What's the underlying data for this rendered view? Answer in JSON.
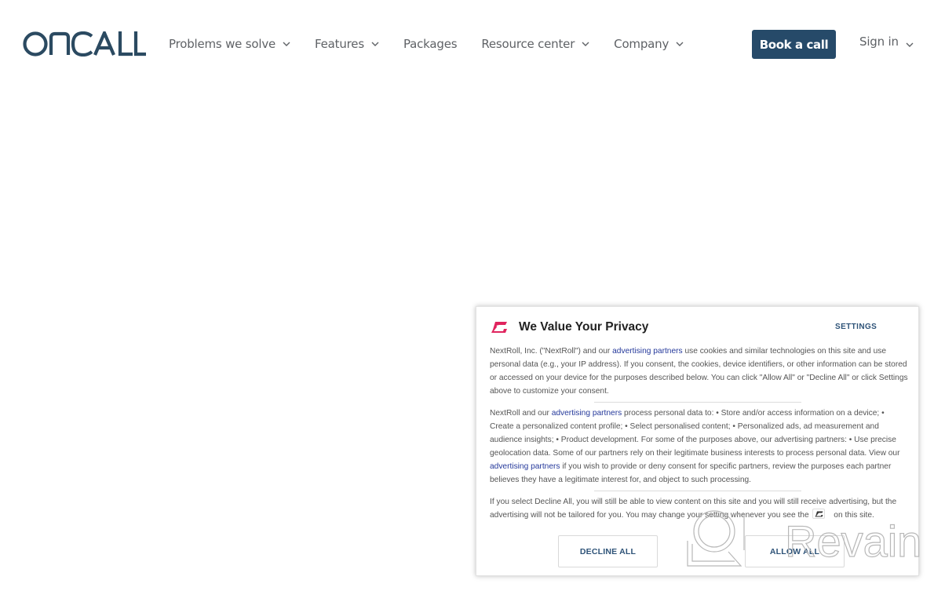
{
  "header": {
    "logo_text": "ONCALL",
    "nav": [
      {
        "label": "Problems we solve",
        "has_dropdown": true
      },
      {
        "label": "Features",
        "has_dropdown": true
      },
      {
        "label": "Packages",
        "has_dropdown": false
      },
      {
        "label": "Resource center",
        "has_dropdown": true
      },
      {
        "label": "Company",
        "has_dropdown": true
      }
    ],
    "cta_label": "Book a call",
    "signin_label": "Sign in"
  },
  "consent": {
    "title": "We Value Your Privacy",
    "settings_label": "SETTINGS",
    "p1": {
      "before": "NextRoll, Inc. (\"NextRoll\") and our ",
      "link": "advertising partners",
      "after": " use cookies and similar technologies on this site and use personal data (e.g., your IP address). If you consent, the cookies, device identifiers, or other information can be stored or accessed on your device for the purposes described below. You can click \"Allow All\" or \"Decline All\" or click Settings above to customize your consent."
    },
    "p2": {
      "before": "NextRoll and our ",
      "link": "advertising partners",
      "middle": " process personal data to: • Store and/or access information on a device; • Create a personalized content profile; • Select personalised content; • Personalized ads, ad measurement and audience insights; • Product development. For some of the purposes above, our advertising partners: • Use precise geolocation data. Some of our partners rely on their legitimate business interests to process personal data. View our ",
      "link2": "advertising partners",
      "after": " if you wish to provide or deny consent for specific partners, review the purposes each partner believes they have a legitimate interest for, and object to such processing."
    },
    "p3": {
      "before": "If you select Decline All, you will still be able to view content on this site and you will still receive advertising, but the advertising will not be tailored for you. You may change your setting whenever you see the ",
      "after": " on this site."
    },
    "decline_label": "DECLINE ALL",
    "allow_label": "ALLOW ALL"
  },
  "watermark": {
    "text": "Revain"
  },
  "colors": {
    "brand_navy": "#264a69",
    "nextroll_pink": "#e0245e",
    "link_blue": "#25399b"
  }
}
